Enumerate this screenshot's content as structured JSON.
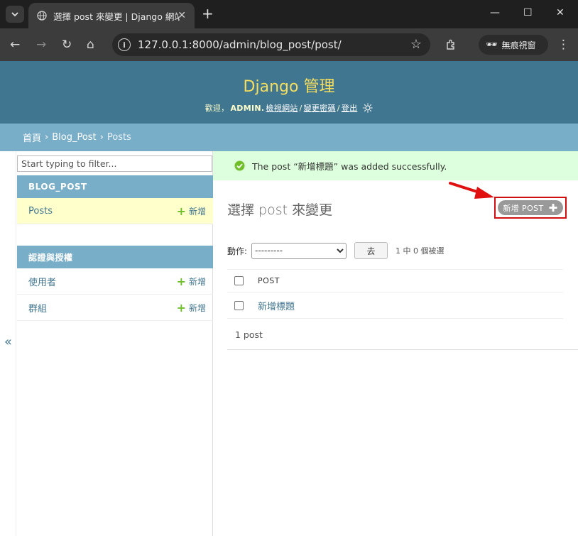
{
  "browser": {
    "tab_title": "選擇 post 來變更 | Django 網站管理",
    "url": "127.0.0.1:8000/admin/blog_post/post/",
    "incognito_label": "無痕視窗"
  },
  "header": {
    "site_name": "Django 管理",
    "welcome": "歡迎，",
    "username": "ADMIN.",
    "view_site": "檢視網站",
    "change_password": "變更密碼",
    "logout": "登出",
    "sep": "/"
  },
  "breadcrumbs": {
    "home": "首頁",
    "app": "Blog_Post",
    "current": "Posts",
    "gt": "›"
  },
  "sidebar": {
    "filter_placeholder": "Start typing to filter...",
    "apps": [
      {
        "caption": "BLOG_POST",
        "models": [
          {
            "label": "Posts",
            "add": "新增"
          }
        ]
      },
      {
        "caption": "認證與授權",
        "models": [
          {
            "label": "使用者",
            "add": "新增"
          },
          {
            "label": "群組",
            "add": "新增"
          }
        ]
      }
    ],
    "collapse": "«"
  },
  "message": {
    "text": "The post “新增標題” was added successfully."
  },
  "main": {
    "title": "選擇 post 來變更",
    "add_button": "新增 POST",
    "actions_label": "動作:",
    "action_default": "---------",
    "go_button": "去",
    "action_counter": "1 中 0 個被選",
    "column_header": "POST",
    "rows": [
      {
        "title": "新增標題"
      }
    ],
    "paginator": "1 post"
  },
  "colors": {
    "header_bg": "#417690",
    "site_name": "#f5dd5d",
    "breadcrumb_bg": "#79aec8",
    "success_bg": "#ddffdd",
    "highlight_red": "#d01010"
  }
}
